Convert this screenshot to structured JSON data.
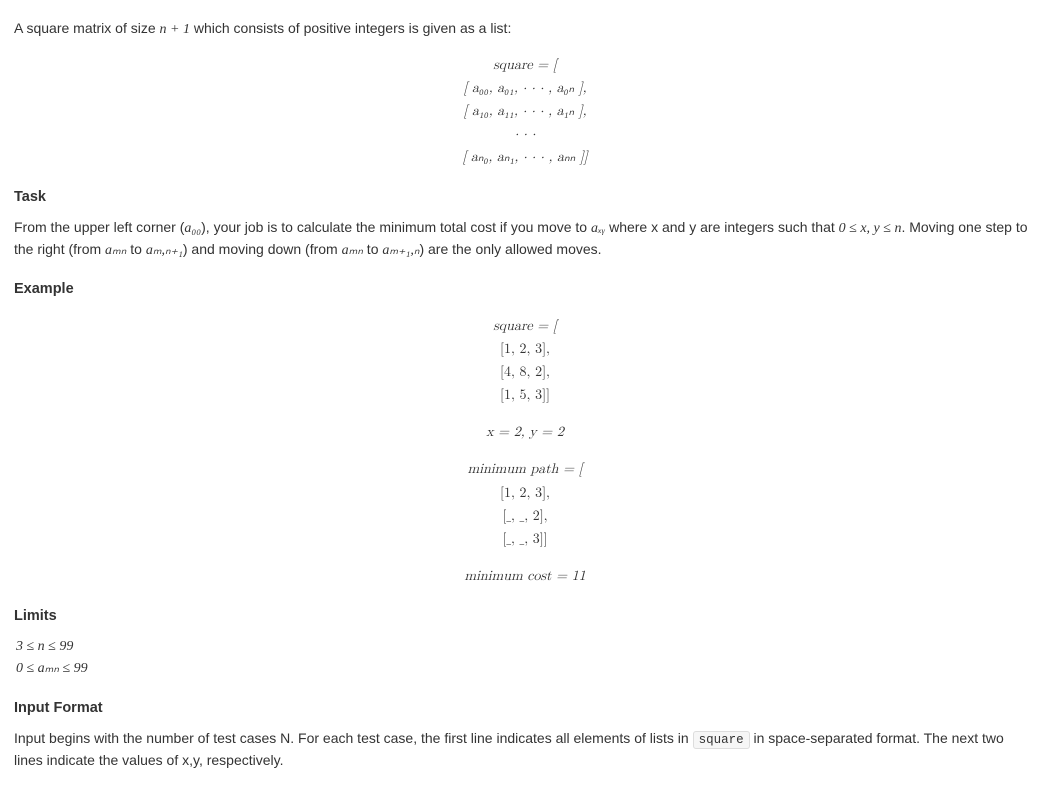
{
  "intro": {
    "before_n": "A square matrix of size ",
    "n_expr": "n + 1",
    "after_n": " which consists of positive integers is given as a list:"
  },
  "matrix_def": {
    "line0": "square = [",
    "row0": "[ a₀₀, a₀₁, · · · , a₀ₙ ],",
    "row1": "[ a₁₀, a₁₁, · · · , a₁ₙ ],",
    "dots": "· · ·",
    "rown": "[ aₙ₀, aₙ₁, · · · , aₙₙ ]]"
  },
  "task": {
    "heading": "Task",
    "p1a": "From the upper left corner (",
    "a00": "a₀₀",
    "p1b": "), your job is to calculate the minimum total cost if you move to ",
    "axy": "aₓᵧ",
    "p1c": " where x and y are integers such that ",
    "range": "0 ≤ x, y ≤ n",
    "p1d": ". Moving one step to the right (from ",
    "amn": "aₘₙ",
    "p1e": " to ",
    "amn1": "aₘ,ₙ₊₁",
    "p1f": ") and moving down (from ",
    "amn2": "aₘₙ",
    "p1g": " to ",
    "am1n": "aₘ₊₁,ₙ",
    "p1h": ") are the only allowed moves."
  },
  "example": {
    "heading": "Example",
    "sq_label": "square = [",
    "r0": "[1, 2, 3],",
    "r1": "[4, 8, 2],",
    "r2": "[1, 5, 3]]",
    "xy": "x = 2,  y = 2",
    "mp_label": "minimum path = [",
    "mp0": "[1, 2, 3],",
    "mp1": "[_, _, 2],",
    "mp2": "[_, _, 3]]",
    "cost": "minimum cost = 11"
  },
  "limits": {
    "heading": "Limits",
    "l1": "3 ≤ n ≤ 99",
    "l2": "0 ≤ aₘₙ ≤ 99"
  },
  "input": {
    "heading": "Input Format",
    "p_a": "Input begins with the number of test cases N. For each test case, the first line indicates all elements of lists in ",
    "code": "square",
    "p_b": " in space-separated format. The next two lines indicate the values of x,y, respectively."
  },
  "chart_data": {
    "type": "table",
    "square": [
      [
        1,
        2,
        3
      ],
      [
        4,
        8,
        2
      ],
      [
        1,
        5,
        3
      ]
    ],
    "x": 2,
    "y": 2,
    "minimum_path": [
      [
        1,
        2,
        3
      ],
      [
        null,
        null,
        2
      ],
      [
        null,
        null,
        3
      ]
    ],
    "minimum_cost": 11,
    "n_range": [
      3,
      99
    ],
    "a_range": [
      0,
      99
    ]
  }
}
